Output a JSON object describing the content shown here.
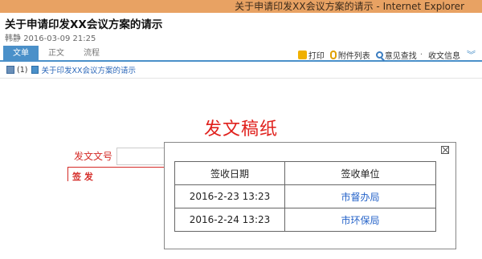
{
  "window": {
    "title": "关于申请印发XX会议方案的请示 - Internet Explorer"
  },
  "document": {
    "title": "关于申请印发XX会议方案的请示",
    "author": "韩静",
    "date": "2016-03-09 21:25"
  },
  "tabs": [
    {
      "label": "文单",
      "active": true
    },
    {
      "label": "正文",
      "active": false
    },
    {
      "label": "流程",
      "active": false
    }
  ],
  "toolbar": {
    "print": "打印",
    "attachments": "附件列表",
    "opinion_search": "意见查找",
    "separator": "·",
    "receipt_info": "收文信息"
  },
  "attachments": {
    "count": "(1)",
    "item": "关于印发XX会议方案的请示"
  },
  "form": {
    "heading": "发文稿纸",
    "doc_number_label": "发文文号",
    "sign_label": "签 发"
  },
  "popup": {
    "headers": [
      "签收日期",
      "签收单位"
    ],
    "rows": [
      {
        "date": "2016-2-23 13:23",
        "unit": "市督办局"
      },
      {
        "date": "2016-2-24 13:23",
        "unit": "市环保局"
      }
    ]
  },
  "colors": {
    "titlebar": "#e8a263",
    "accent": "#4a90c9",
    "form_red": "#e0201c",
    "link": "#2563c9"
  }
}
